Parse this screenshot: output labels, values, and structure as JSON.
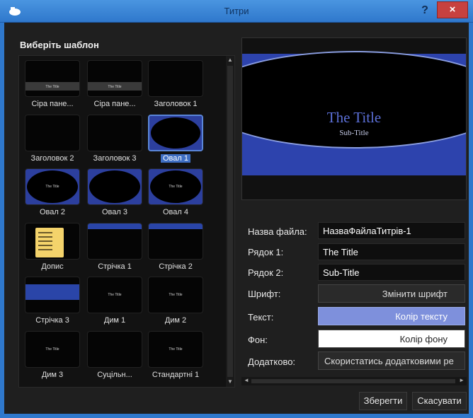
{
  "window": {
    "title": "Титри",
    "help": "?",
    "close": "×"
  },
  "template_panel": {
    "label": "Виберіть шаблон",
    "templates": [
      {
        "label": "Сіра пане...",
        "preview_title": "The Title"
      },
      {
        "label": "Сіра пане...",
        "preview_title": "The Title"
      },
      {
        "label": "Заголовок 1"
      },
      {
        "label": "Заголовок 2"
      },
      {
        "label": "Заголовок 3"
      },
      {
        "label": "Овал 1",
        "selected": true
      },
      {
        "label": "Овал 2",
        "preview_title": "The Title"
      },
      {
        "label": "Овал 3"
      },
      {
        "label": "Овал 4",
        "preview_title": "The Title"
      },
      {
        "label": "Допис"
      },
      {
        "label": "Стрічка 1"
      },
      {
        "label": "Стрічка 2"
      },
      {
        "label": "Стрічка 3"
      },
      {
        "label": "Дим 1",
        "preview_title": "The Title"
      },
      {
        "label": "Дим 2",
        "preview_title": "The Title"
      },
      {
        "label": "Дим 3",
        "preview_title": "The Title"
      },
      {
        "label": "Суцільн..."
      },
      {
        "label": "Стандартні 1",
        "preview_title": "The Title"
      }
    ]
  },
  "preview": {
    "title": "The Title",
    "subtitle": "Sub-Title"
  },
  "form": {
    "filename_label": "Назва файла:",
    "filename_value": "НазваФайлаТитрів-1",
    "line1_label": "Рядок 1:",
    "line1_value": "The Title",
    "line2_label": "Рядок 2:",
    "line2_value": "Sub-Title",
    "font_label": "Шрифт:",
    "font_button": "Змінити шрифт",
    "text_label": "Текст:",
    "text_button": "Колір тексту",
    "bg_label": "Фон:",
    "bg_button": "Колір фону",
    "extra_label": "Додатково:",
    "extra_button": "Скористатись додатковими ре"
  },
  "actions": {
    "save": "Зберегти",
    "cancel": "Скасувати"
  },
  "colors": {
    "accent": "#2f78cc",
    "text_color": "#7e90dc",
    "bg_color": "#ffffff",
    "close": "#c7413f"
  }
}
